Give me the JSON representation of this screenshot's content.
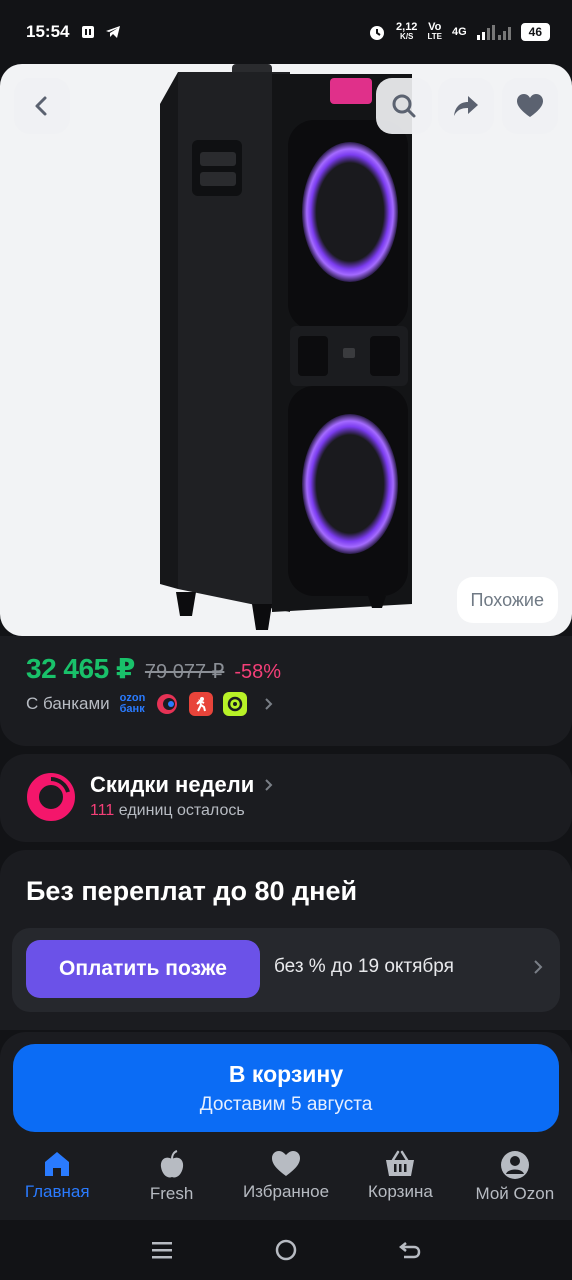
{
  "status_bar": {
    "time": "15:54",
    "speed_value": "2,12",
    "speed_unit": "K/S",
    "volte_top": "Vo",
    "volte_bottom": "LTE",
    "network": "4G",
    "battery": "46"
  },
  "hero": {
    "similar_label": "Похожие"
  },
  "price": {
    "current": "32 465 ₽",
    "old": "79 077 ₽",
    "discount": "-58%",
    "banks_label": "С банками",
    "ozon_bank_top": "ozon",
    "ozon_bank_bottom": "банк"
  },
  "deals": {
    "title": "Скидки недели",
    "count": "111",
    "remaining_text": "единиц осталось"
  },
  "bnpl": {
    "title": "Без переплат до 80 дней",
    "button_label": "Оплатить позже",
    "terms": "без % до 19 октября"
  },
  "cart": {
    "button_label": "В корзину",
    "delivery": "Доставим 5 августа"
  },
  "bottom_nav": [
    {
      "label": "Главная",
      "icon": "home-icon",
      "active": true
    },
    {
      "label": "Fresh",
      "icon": "fresh-apple-icon",
      "active": false
    },
    {
      "label": "Избранное",
      "icon": "heart-icon",
      "active": false
    },
    {
      "label": "Корзина",
      "icon": "basket-icon",
      "active": false
    },
    {
      "label": "Мой Ozon",
      "icon": "profile-icon",
      "active": false
    }
  ],
  "colors": {
    "background": "#121316",
    "card": "#1b1c20",
    "price_green": "#19c16a",
    "discount_pink": "#f43f78",
    "accent_blue": "#0b6cf5",
    "pay_later_purple": "#6b52e8"
  }
}
